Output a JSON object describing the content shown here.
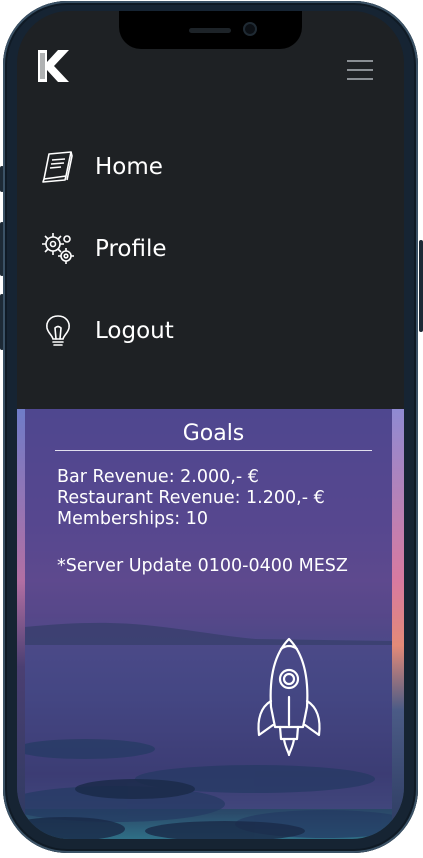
{
  "brand": {
    "logo_letter": "K",
    "logo_icon": "k-logo-icon"
  },
  "header": {
    "menu_icon": "hamburger-menu-icon"
  },
  "nav": {
    "items": [
      {
        "label": "Home",
        "icon": "book-icon"
      },
      {
        "label": "Profile",
        "icon": "gears-icon"
      },
      {
        "label": "Logout",
        "icon": "lightbulb-icon"
      }
    ]
  },
  "goals": {
    "title": "Goals",
    "lines": [
      "Bar Revenue: 2.000,- €",
      "Restaurant Revenue: 1.200,- €",
      "Memberships: 10"
    ],
    "note": "*Server Update 0100-0400 MESZ",
    "illustration_icon": "rocket-icon"
  },
  "colors": {
    "sidebar_bg": "#1e2124",
    "phone_frame": "#162433",
    "text": "#ffffff",
    "panel_overlay": "#53468c"
  }
}
